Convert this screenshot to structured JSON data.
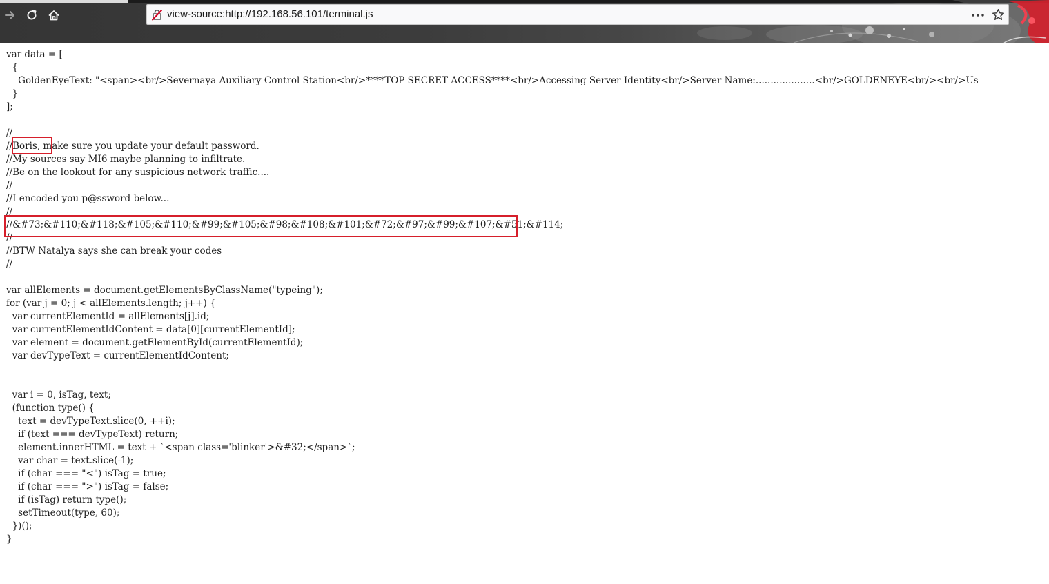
{
  "browser": {
    "url": "view-source:http://192.168.56.101/terminal.js",
    "buttons": {
      "forward": "forward-arrow-icon",
      "reload": "reload-icon",
      "home": "home-icon",
      "page_actions": "more-horizontal-icon",
      "bookmark": "star-icon",
      "connection": "insecure-connection-icon"
    },
    "colors": {
      "toolbar": "#3c3c3c",
      "theme_accent": "#d51f2b",
      "highlight": "#d61f2b"
    }
  },
  "source": {
    "lines": [
      "var data = [",
      "  {",
      "    GoldenEyeText: \"<span><br/>Severnaya Auxiliary Control Station<br/>****TOP SECRET ACCESS****<br/>Accessing Server Identity<br/>Server Name:....................<br/>GOLDENEYE<br/><br/>Us",
      "  }",
      "];",
      "",
      "//",
      "//Boris, make sure you update your default password.",
      "//My sources say MI6 maybe planning to infiltrate.",
      "//Be on the lookout for any suspicious network traffic....",
      "//",
      "//I encoded you p@ssword below...",
      "//",
      "//&#73;&#110;&#118;&#105;&#110;&#99;&#105;&#98;&#108;&#101;&#72;&#97;&#99;&#107;&#51;&#114;",
      "//",
      "//BTW Natalya says she can break your codes",
      "//",
      "",
      "var allElements = document.getElementsByClassName(\"typeing\");",
      "for (var j = 0; j < allElements.length; j++) {",
      "  var currentElementId = allElements[j].id;",
      "  var currentElementIdContent = data[0][currentElementId];",
      "  var element = document.getElementById(currentElementId);",
      "  var devTypeText = currentElementIdContent;",
      "",
      "",
      "  var i = 0, isTag, text;",
      "  (function type() {",
      "    text = devTypeText.slice(0, ++i);",
      "    if (text === devTypeText) return;",
      "    element.innerHTML = text + `<span class='blinker'>&#32;</span>`;",
      "    var char = text.slice(-1);",
      "    if (char === \"<\") isTag = true;",
      "    if (char === \">\") isTag = false;",
      "    if (isTag) return type();",
      "    setTimeout(type, 60);",
      "  })();",
      "}"
    ]
  }
}
